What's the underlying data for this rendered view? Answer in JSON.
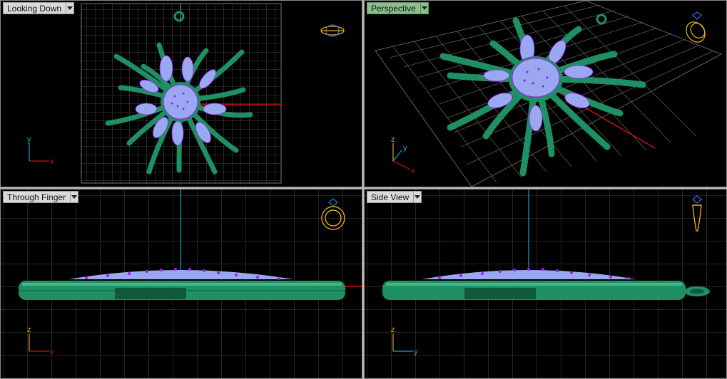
{
  "viewports": [
    {
      "label": "Looking Down",
      "active": false,
      "axes": [
        "x",
        "y"
      ],
      "orientation_icon": "ring-top-view-icon"
    },
    {
      "label": "Perspective",
      "active": true,
      "axes": [
        "x",
        "y",
        "z"
      ],
      "orientation_icon": "ring-perspective-icon"
    },
    {
      "label": "Through Finger",
      "active": false,
      "axes": [
        "x",
        "z"
      ],
      "orientation_icon": "ring-front-view-icon"
    },
    {
      "label": "Side View",
      "active": false,
      "axes": [
        "y",
        "z"
      ],
      "orientation_icon": "ring-side-view-icon"
    }
  ],
  "colors": {
    "background": "#000000",
    "grid": "#5a5a5a",
    "model_metal": "#1f8f64",
    "gem": "#9aa8f2",
    "prong": "#a020f0",
    "axis_x": "#d01010",
    "axis_y": "#18a4c8",
    "axis_z": "#e0a020",
    "icon": "#e8a820"
  }
}
